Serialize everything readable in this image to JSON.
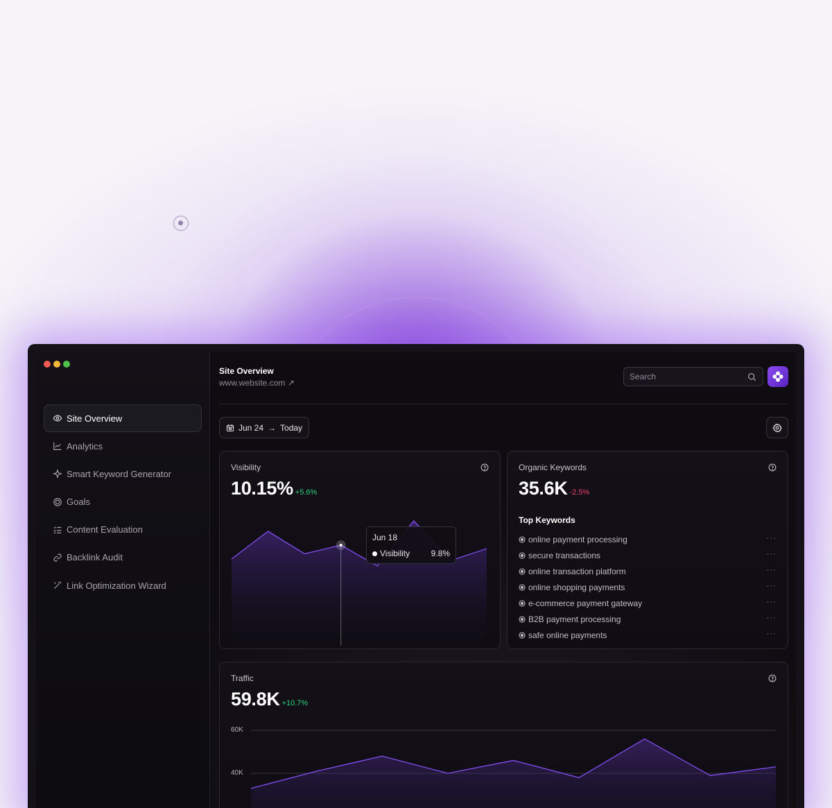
{
  "sidebar": {
    "items": [
      {
        "label": "Site Overview",
        "icon": "eye-icon",
        "active": true
      },
      {
        "label": "Analytics",
        "icon": "line-chart-icon"
      },
      {
        "label": "Smart Keyword Generator",
        "icon": "sparkle-icon"
      },
      {
        "label": "Goals",
        "icon": "target-icon"
      },
      {
        "label": "Content Evaluation",
        "icon": "checklist-icon"
      },
      {
        "label": "Backlink Audit",
        "icon": "link-icon"
      },
      {
        "label": "Link Optimization Wizard",
        "icon": "magic-wand-icon"
      }
    ]
  },
  "header": {
    "title": "Site Overview",
    "url": "www.website.com",
    "url_arrow": "↗",
    "search_placeholder": "Search"
  },
  "filters": {
    "date_from": "Jun 24",
    "arrow": "→",
    "date_to": "Today"
  },
  "visibility": {
    "label": "Visibility",
    "value": "10.15%",
    "change": "+5.6%",
    "tooltip": {
      "date": "Jun 18",
      "series": "Visibility",
      "value": "9.8%"
    },
    "chart_data": {
      "type": "area",
      "values": [
        9.0,
        10.6,
        9.3,
        9.8,
        8.6,
        11.2,
        8.9,
        9.6
      ]
    }
  },
  "organic": {
    "label": "Organic Keywords",
    "value": "35.6K",
    "change": "-2.5%",
    "top_title": "Top Keywords",
    "keywords": [
      "online payment processing",
      "secure transactions",
      "online transaction platform",
      "online shopping payments",
      "e-commerce payment gateway",
      "B2B payment processing",
      "safe online payments"
    ],
    "more": "···"
  },
  "traffic": {
    "label": "Traffic",
    "value": "59.8K",
    "change": "+10.7%",
    "chart_data": {
      "type": "area",
      "yticks": [
        "60K",
        "40K"
      ],
      "ylim": [
        0,
        60000
      ],
      "values": [
        33000,
        41000,
        48000,
        40000,
        46000,
        38000,
        56000,
        39000,
        43000
      ]
    }
  },
  "colors": {
    "accent": "#8a4cf2",
    "positive": "#2fd17d",
    "negative": "#f0416c"
  }
}
